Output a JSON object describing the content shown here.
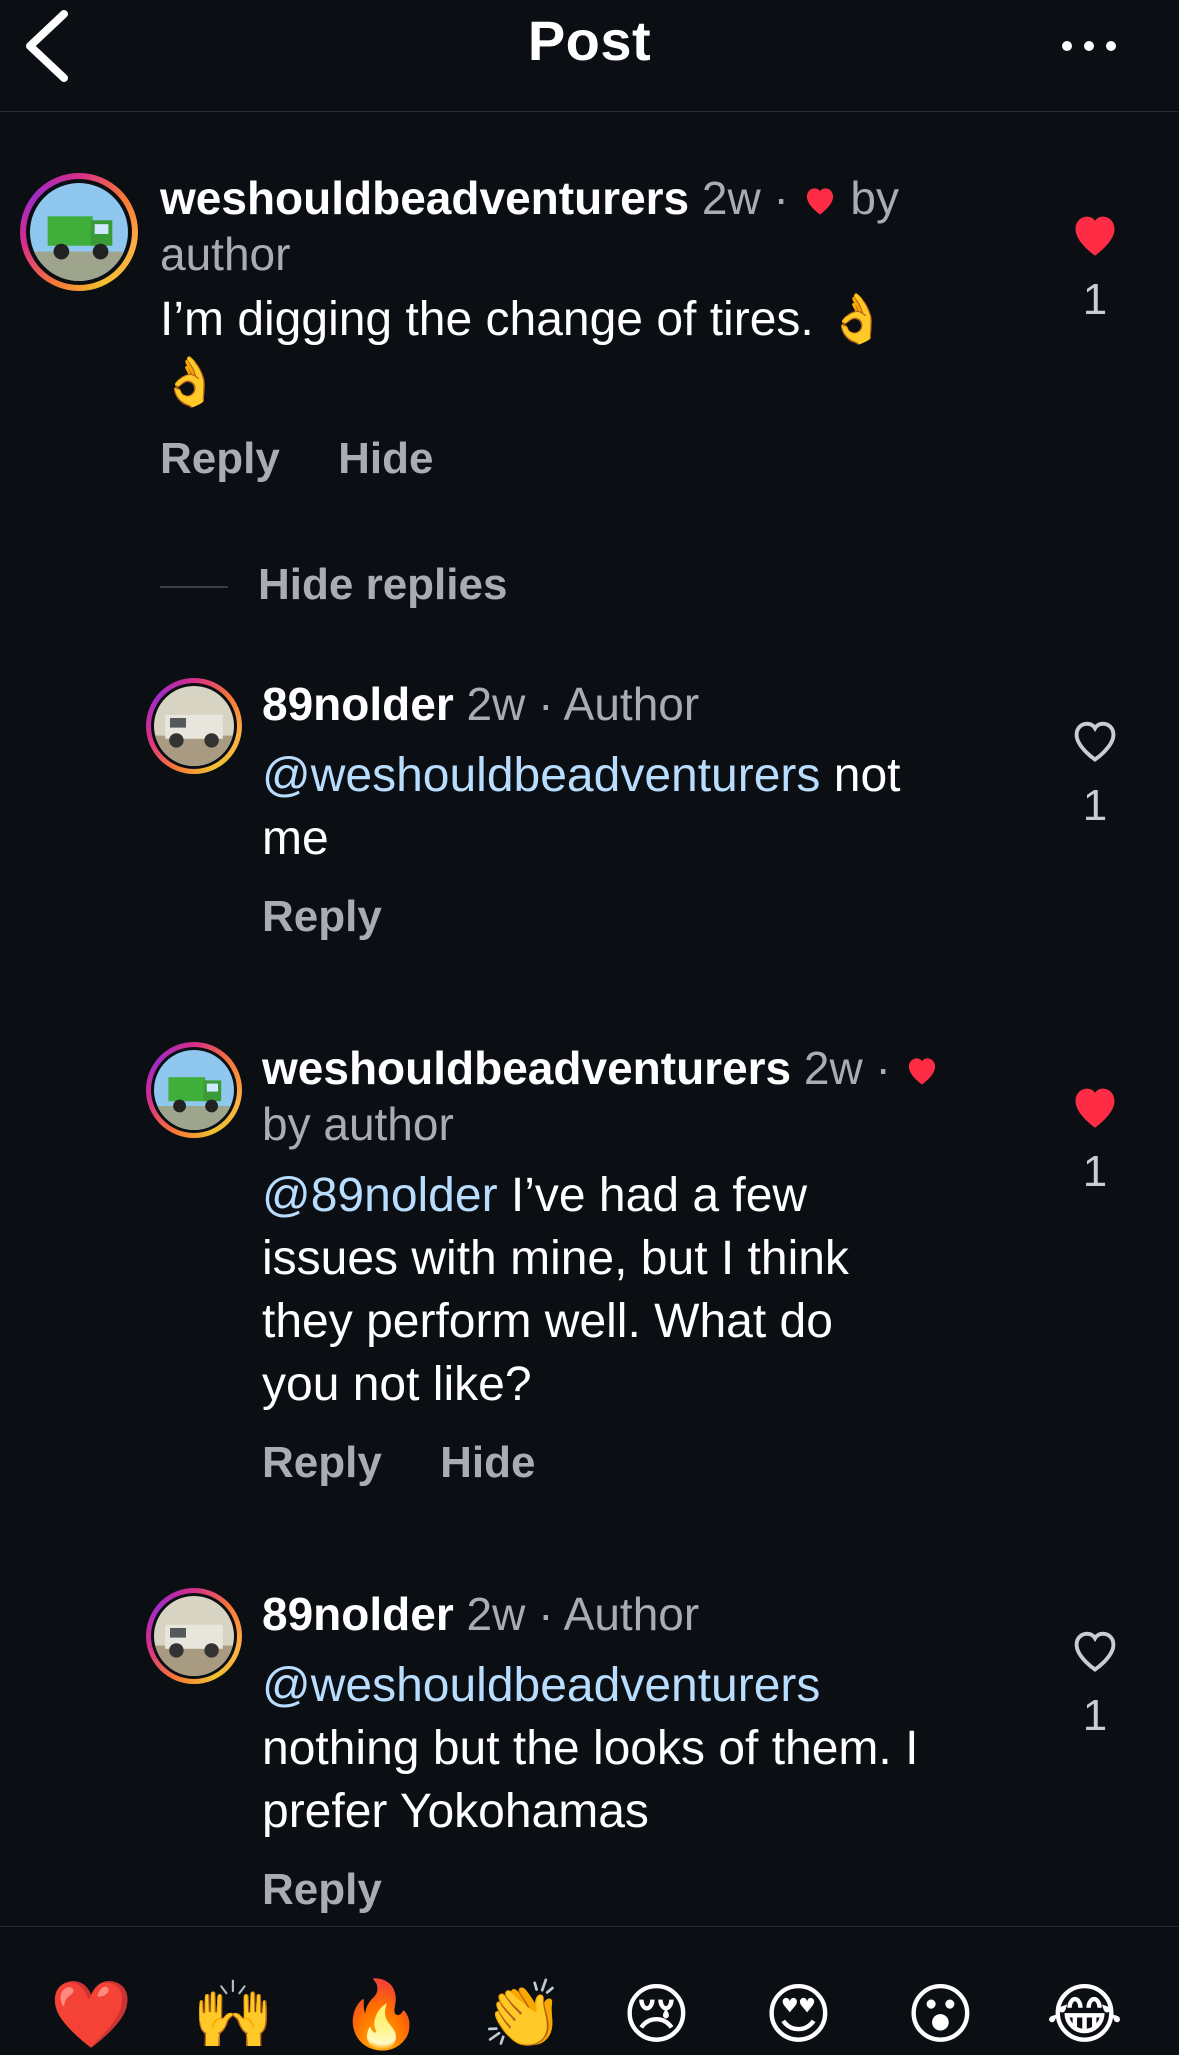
{
  "header": {
    "title": "Post"
  },
  "comments": [
    {
      "username": "weshouldbeadventurers",
      "time": "2w",
      "sep": "·",
      "liked_by": "by author",
      "by": "by",
      "author_word": "author",
      "text": "I’m digging the change of tires. 👌 👌",
      "text_main": "I’m digging the change of tires.",
      "emoji1": "👌",
      "emoji2": "👌",
      "likes": "1",
      "liked": true,
      "reply_label": "Reply",
      "hide_label": "Hide"
    }
  ],
  "hide_replies_label": "Hide replies",
  "replies": [
    {
      "username": "89nolder",
      "time": "2w",
      "badge": "· Author",
      "mention": "@weshouldbeadventurers",
      "text": "not",
      "text2": "me",
      "likes": "1",
      "liked": false,
      "reply_label": "Reply"
    },
    {
      "username": "weshouldbeadventurers",
      "time": "2w",
      "sep": "·",
      "liked_by": "by author",
      "mention": "@89nolder",
      "text_l1": "I’ve had a few",
      "text_l2": "issues with mine, but I think",
      "text_l3": "they perform well. What do",
      "text_l4": "you not like?",
      "likes": "1",
      "liked": true,
      "reply_label": "Reply",
      "hide_label": "Hide"
    },
    {
      "username": "89nolder",
      "time": "2w",
      "badge": "· Author",
      "mention": "@weshouldbeadventurers",
      "text_l1": "nothing but the looks of them. I",
      "text_l2": "prefer Yokohamas",
      "likes": "1",
      "liked": false,
      "reply_label": "Reply"
    }
  ],
  "emoji_bar": [
    "❤️",
    "🙌",
    "🔥",
    "👏",
    "😢",
    "😍",
    "😮",
    "😂"
  ],
  "colors": {
    "like_red": "#fe2c45",
    "mention_blue": "#b9ddff",
    "background": "#0b0e13"
  }
}
